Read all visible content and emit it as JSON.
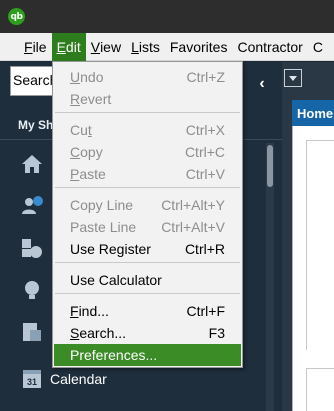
{
  "app": {
    "logo_text": "qb"
  },
  "menubar": {
    "items": [
      {
        "label": "File",
        "underline_index": 0
      },
      {
        "label": "Edit",
        "underline_index": 0,
        "active": true
      },
      {
        "label": "View",
        "underline_index": 0
      },
      {
        "label": "Lists",
        "underline_index": 0
      },
      {
        "label": "Favorites"
      },
      {
        "label": "Contractor"
      },
      {
        "label": "C"
      }
    ]
  },
  "leftnav": {
    "search_text": "Search",
    "section_title": "My Sh",
    "collapse_icon": "chevron-left-icon",
    "icons": [
      "home-icon",
      "customers-icon",
      "vendors-icon",
      "employees-icon",
      "docs-icon"
    ],
    "calendar_icon_text": "31",
    "calendar_label": "Calendar"
  },
  "rightpanel": {
    "home_tab": "Home"
  },
  "edit_menu": {
    "items": [
      {
        "label_pre": "",
        "label_u": "U",
        "label_post": "ndo",
        "shortcut": "Ctrl+Z",
        "disabled": true
      },
      {
        "label_pre": "",
        "label_u": "R",
        "label_post": "evert",
        "shortcut": "",
        "disabled": true
      },
      {
        "label_pre": "Cu",
        "label_u": "t",
        "label_post": "",
        "shortcut": "Ctrl+X",
        "disabled": true
      },
      {
        "label_pre": "",
        "label_u": "C",
        "label_post": "opy",
        "shortcut": "Ctrl+C",
        "disabled": true
      },
      {
        "label_pre": "",
        "label_u": "P",
        "label_post": "aste",
        "shortcut": "Ctrl+V",
        "disabled": true
      },
      {
        "label_pre": "Copy Line",
        "label_u": "",
        "label_post": "",
        "shortcut": "Ctrl+Alt+Y",
        "disabled": true
      },
      {
        "label_pre": "Paste Line",
        "label_u": "",
        "label_post": "",
        "shortcut": "Ctrl+Alt+V",
        "disabled": true
      },
      {
        "label_pre": "Use Register",
        "label_u": "",
        "label_post": "",
        "shortcut": "Ctrl+R",
        "disabled": false
      },
      {
        "label_pre": "Use Calculator",
        "label_u": "",
        "label_post": "",
        "shortcut": "",
        "disabled": false
      },
      {
        "label_pre": "",
        "label_u": "F",
        "label_post": "ind...",
        "shortcut": "Ctrl+F",
        "disabled": false
      },
      {
        "label_pre": "",
        "label_u": "S",
        "label_post": "earch...",
        "shortcut": "F3",
        "disabled": false
      },
      {
        "label_pre": "Preferences...",
        "label_u": "",
        "label_post": "",
        "shortcut": "",
        "disabled": false,
        "highlighted": true
      }
    ]
  }
}
